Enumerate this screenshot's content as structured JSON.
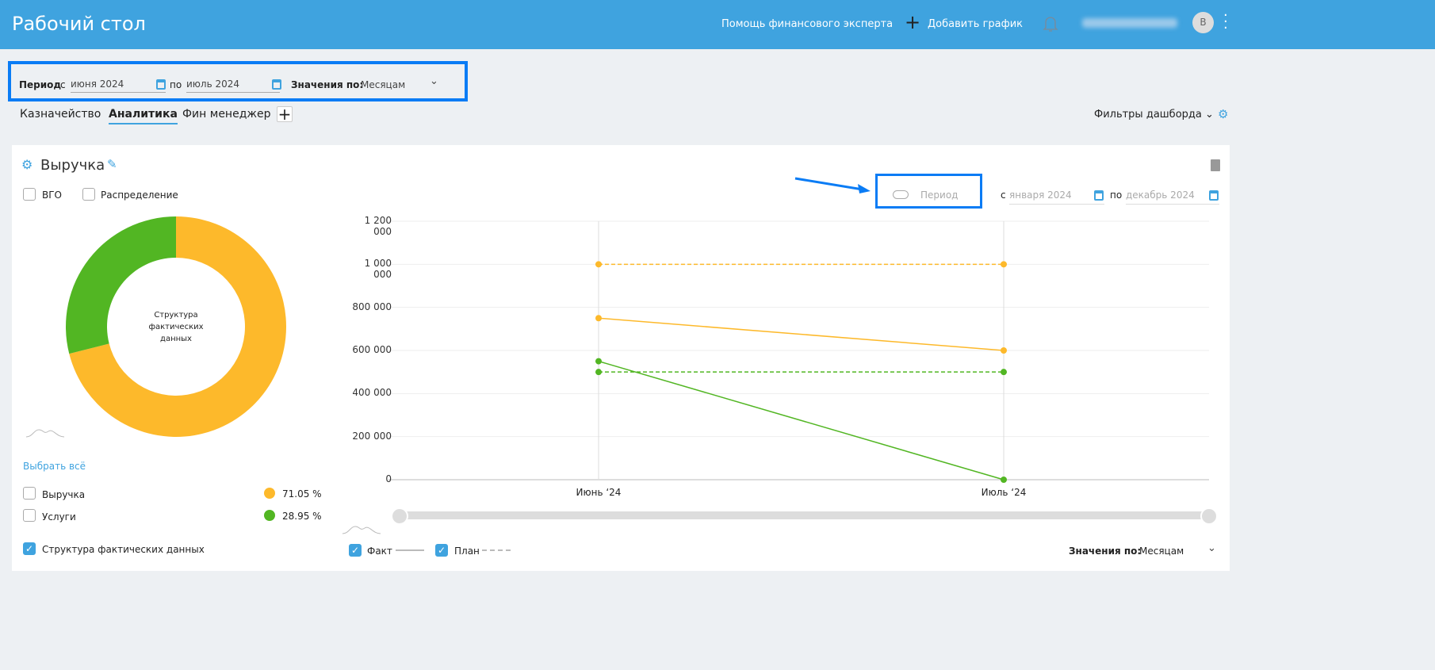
{
  "header": {
    "title": "Рабочий стол",
    "help": "Помощь финансового эксперта",
    "add_chart": "Добавить график",
    "avatar": "В"
  },
  "filters": {
    "period_label": "Период",
    "from_prefix": "с",
    "from": "июня 2024",
    "to_prefix": "по",
    "to": "июль 2024",
    "values_label": "Значения по:",
    "values": "Месяцам"
  },
  "tabs": [
    "Казначейство",
    "Аналитика",
    "Фин менеджер"
  ],
  "active_tab": 1,
  "dashboard_filters": "Фильтры дашборда",
  "widget": {
    "title": "Выручка",
    "vgo": "ВГО",
    "distribution": "Распределение",
    "period_toggle": "Период",
    "from_prefix": "с",
    "from": "января 2024",
    "to_prefix": "по",
    "to": "декабрь 2024",
    "donut_center": "Структура фактических данных",
    "select_all": "Выбрать всё",
    "legend": [
      {
        "label": "Выручка",
        "pct": "71.05 %",
        "value": 71.05,
        "color": "#fdb92b"
      },
      {
        "label": "Услуги",
        "pct": "28.95 %",
        "value": 28.95,
        "color": "#52b623"
      }
    ],
    "structure": "Структура фактических данных",
    "fact": "Факт",
    "plan": "План",
    "values_label": "Значения по:",
    "values": "Месяцам"
  },
  "chart_data": {
    "type": "line",
    "categories": [
      "Июнь ‘24",
      "Июль ‘24"
    ],
    "yticks": [
      "0",
      "200 000",
      "400 000",
      "600 000",
      "800 000",
      "1 000 000",
      "1 200 000"
    ],
    "ylim": [
      0,
      1200000
    ],
    "series": [
      {
        "name": "Выручка факт",
        "color": "#fdb92b",
        "dashed": false,
        "values": [
          750000,
          600000
        ]
      },
      {
        "name": "Выручка план",
        "color": "#fdb92b",
        "dashed": true,
        "values": [
          1000000,
          1000000
        ]
      },
      {
        "name": "Услуги факт",
        "color": "#52b623",
        "dashed": false,
        "values": [
          550000,
          0
        ]
      },
      {
        "name": "Услуги план",
        "color": "#52b623",
        "dashed": true,
        "values": [
          500000,
          500000
        ]
      }
    ]
  }
}
